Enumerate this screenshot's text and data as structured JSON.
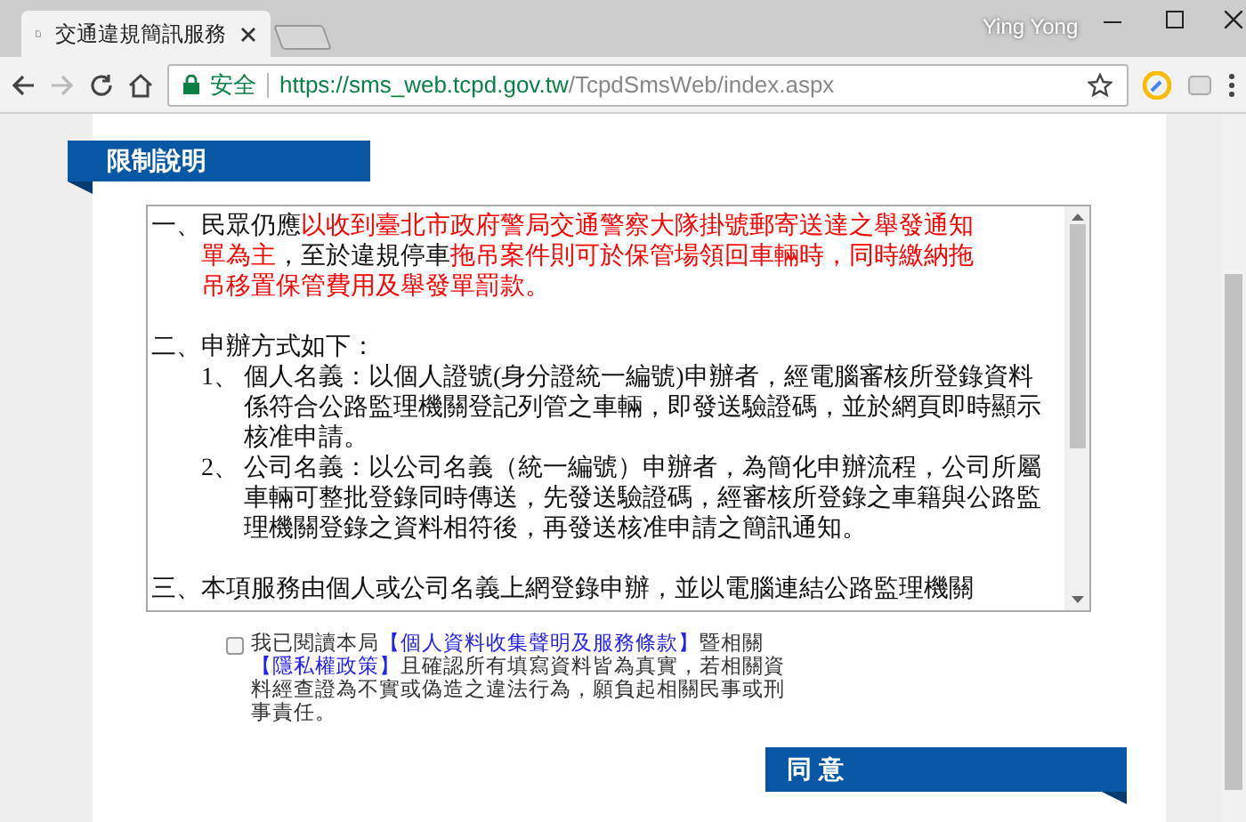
{
  "browser": {
    "tab_title": "交通違規簡訊服務",
    "user": "Ying Yong",
    "security_label": "安全",
    "url_host": "https://sms_web.tcpd.gov.tw",
    "url_path": "/TcpdSmsWeb/index.aspx"
  },
  "section_title": "限制說明",
  "terms": [
    {
      "marker": "一、",
      "segments": [
        {
          "text": "民眾仍應",
          "highlight": false
        },
        {
          "text": "以收到臺北市政府警局交通警察大隊掛號郵寄送達之舉發通知單為主",
          "highlight": true
        },
        {
          "text": "，至於違規停車",
          "highlight": false
        },
        {
          "text": "拖吊案件則可於保管場領回車輛時，同時繳納拖吊移置保管費用及舉發單罰款。",
          "highlight": true
        }
      ]
    },
    {
      "marker": "二、",
      "segments": [
        {
          "text": "申辦方式如下：",
          "highlight": false
        }
      ],
      "children": [
        {
          "marker": "1、",
          "text": "個人名義：以個人證號(身分證統一編號)申辦者，經電腦審核所登錄資料係符合公路監理機關登記列管之車輛，即發送驗證碼，並於網頁即時顯示核准申請。"
        },
        {
          "marker": "2、",
          "text": "公司名義：以公司名義（統一編號）申辦者，為簡化申辦流程，公司所屬車輛可整批登錄同時傳送，先發送驗證碼，經審核所登錄之車籍與公路監理機關登錄之資料相符後，再發送核准申請之簡訊通知。"
        }
      ]
    },
    {
      "marker": "三、",
      "segments": [
        {
          "text": "本項服務由個人或公司名義上網登錄申辦，並以電腦連結公路監理機關",
          "highlight": false
        }
      ]
    }
  ],
  "consent": {
    "checked": false,
    "parts": [
      {
        "kind": "text",
        "text": "我已閱讀本局"
      },
      {
        "kind": "link",
        "text": "【個人資料收集聲明及服務條款】"
      },
      {
        "kind": "text",
        "text": "暨相關 "
      },
      {
        "kind": "link",
        "text": "【隱私權政策】"
      },
      {
        "kind": "text",
        "text": "且確認所有填寫資料皆為真實，若相關資料經查證為不實或偽造之違法行為，願負起相關民事或刑事責任。"
      }
    ]
  },
  "agree_button": "同 意"
}
